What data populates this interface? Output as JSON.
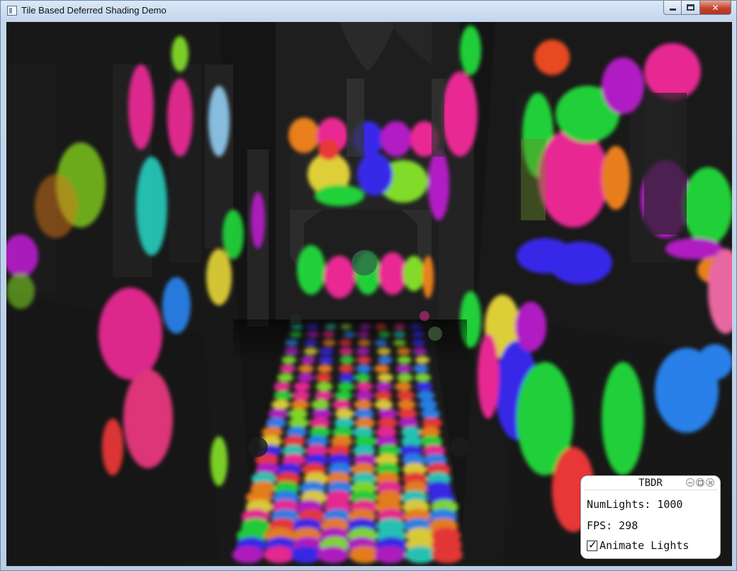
{
  "window": {
    "title": "Tile Based Deferred Shading Demo",
    "minimize_glyph": "",
    "maximize_glyph": "",
    "close_glyph": "✕"
  },
  "panel": {
    "title": "TBDR",
    "num_lights_label": "NumLights:",
    "num_lights_value": "1000",
    "fps_label": "FPS:",
    "fps_value": "298",
    "animate_label": "Animate Lights",
    "animate_checked": true,
    "check_glyph": "✓"
  },
  "colors": {
    "light_palette": [
      "#ff2aa0",
      "#21e43c",
      "#3b2cff",
      "#ff8a1c",
      "#c21cd6",
      "#25d9c7",
      "#f3e23a",
      "#ff3b3b",
      "#8cf02a",
      "#2a8cff"
    ],
    "titlebar": "#c2d6ee",
    "close_button": "#c4442e"
  }
}
